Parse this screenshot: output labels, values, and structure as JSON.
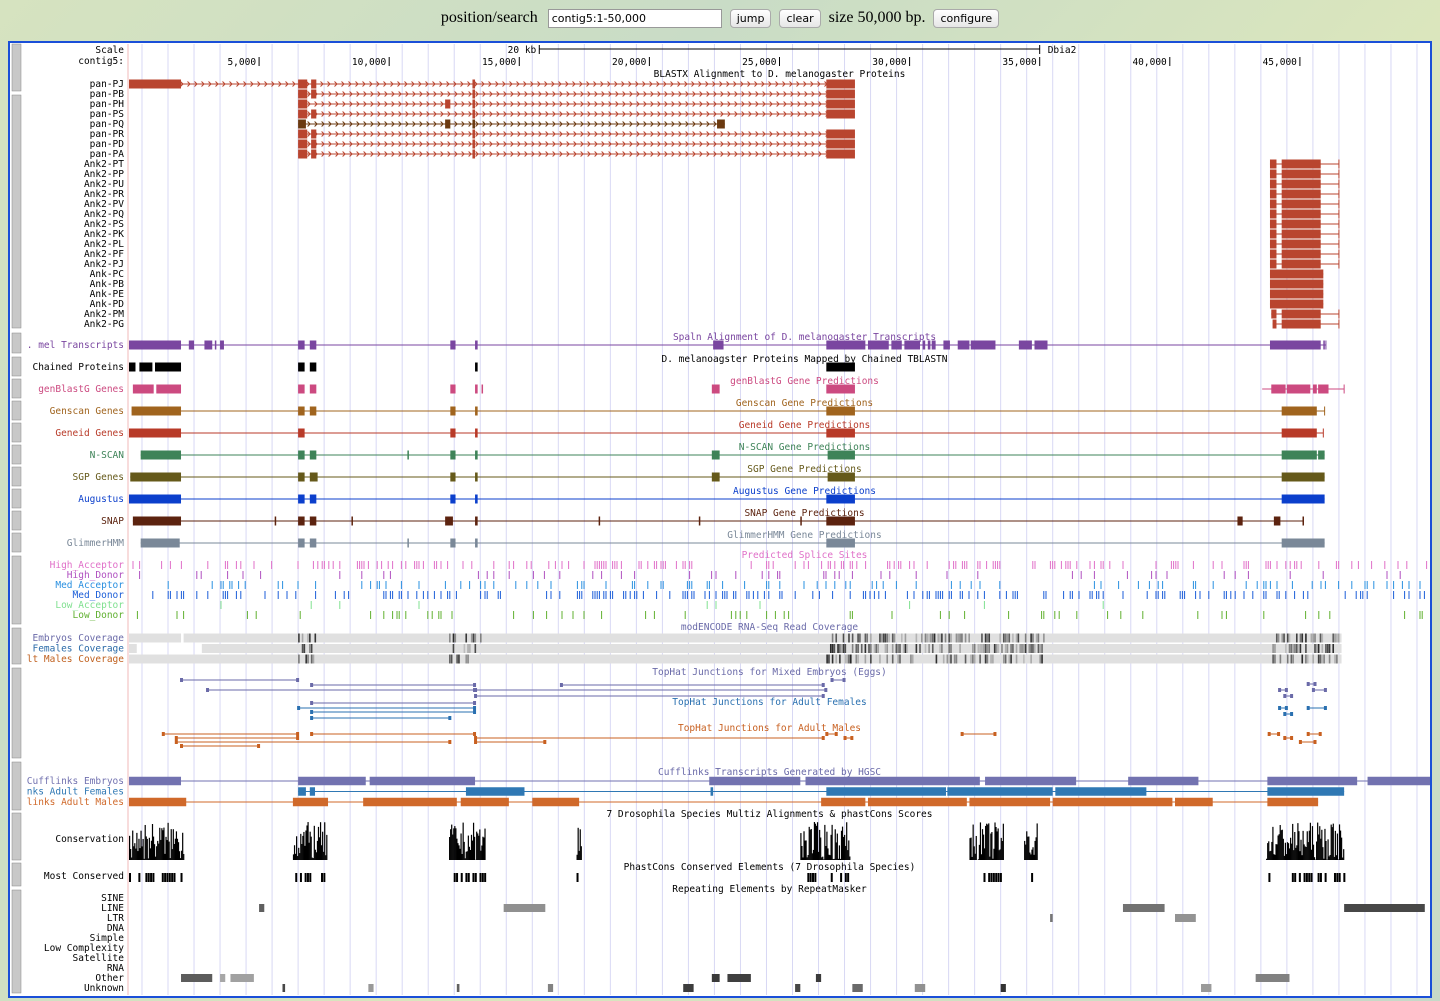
{
  "toolbar": {
    "position_label": "position/search",
    "position_value": "contig5:1-50,000",
    "jump_label": "jump",
    "clear_label": "clear",
    "size_text": "size 50,000 bp.",
    "configure_label": "configure"
  },
  "ruler": {
    "scale_label": "Scale",
    "chrom_label": "contig5:",
    "scale_bar_text": "20 kb",
    "assembly": "Dbia2",
    "ticks": [
      "5,000",
      "10,000",
      "15,000",
      "20,000",
      "25,000",
      "30,000",
      "35,000",
      "40,000",
      "45,000"
    ],
    "tick_positions_bp": [
      5000,
      10000,
      15000,
      20000,
      25000,
      30000,
      35000,
      40000,
      45000
    ],
    "range_bp": [
      1,
      50000
    ]
  },
  "tracks": {
    "blastx": {
      "title": "BLASTX Alignment to D. melanogaster Proteins",
      "color": "#b9452f",
      "alt_color": "#6b3a10",
      "items": [
        {
          "label": "pan-PJ",
          "exons": [
            [
              1,
              2000
            ],
            [
              6500,
              6850
            ],
            [
              7000,
              7200
            ],
            [
              13200,
              13300
            ],
            [
              26800,
              27900
            ]
          ]
        },
        {
          "label": "pan-PB",
          "exons": [
            [
              6500,
              6850
            ],
            [
              7000,
              7200
            ],
            [
              13200,
              13300
            ],
            [
              26800,
              27900
            ]
          ]
        },
        {
          "label": "pan-PH",
          "exons": [
            [
              6500,
              6850
            ],
            [
              12150,
              12350
            ],
            [
              13200,
              13300
            ],
            [
              26800,
              27900
            ]
          ]
        },
        {
          "label": "pan-PS",
          "exons": [
            [
              6500,
              6850
            ],
            [
              7000,
              7200
            ],
            [
              13200,
              13300
            ],
            [
              26800,
              27900
            ]
          ]
        },
        {
          "label": "pan-PQ",
          "exons": [
            [
              6500,
              6800
            ],
            [
              12150,
              12350
            ],
            [
              13200,
              13300
            ],
            [
              22600,
              22900
            ]
          ],
          "alt": true
        },
        {
          "label": "pan-PR",
          "exons": [
            [
              6500,
              6850
            ],
            [
              7000,
              7200
            ],
            [
              13200,
              13300
            ],
            [
              26800,
              27900
            ]
          ]
        },
        {
          "label": "pan-PD",
          "exons": [
            [
              6500,
              6850
            ],
            [
              7000,
              7200
            ],
            [
              13200,
              13300
            ],
            [
              26800,
              27900
            ]
          ]
        },
        {
          "label": "pan-PA",
          "exons": [
            [
              6500,
              6850
            ],
            [
              7000,
              7200
            ],
            [
              13200,
              13300
            ],
            [
              26800,
              27900
            ]
          ]
        },
        {
          "label": "Ank2-PT",
          "exons": [
            [
              43850,
              44100
            ],
            [
              44300,
              45800
            ]
          ],
          "tail": 46500
        },
        {
          "label": "Ank2-PP",
          "exons": [
            [
              43850,
              44100
            ],
            [
              44300,
              45800
            ]
          ],
          "tail": 46500
        },
        {
          "label": "Ank2-PU",
          "exons": [
            [
              43850,
              44100
            ],
            [
              44300,
              45800
            ]
          ],
          "tail": 46500
        },
        {
          "label": "Ank2-PR",
          "exons": [
            [
              43850,
              44100
            ],
            [
              44300,
              45800
            ]
          ],
          "tail": 46500
        },
        {
          "label": "Ank2-PV",
          "exons": [
            [
              43850,
              44100
            ],
            [
              44300,
              45800
            ]
          ],
          "tail": 46500
        },
        {
          "label": "Ank2-PQ",
          "exons": [
            [
              43850,
              44100
            ],
            [
              44300,
              45800
            ]
          ],
          "tail": 46500
        },
        {
          "label": "Ank2-PS",
          "exons": [
            [
              43850,
              44100
            ],
            [
              44300,
              45800
            ]
          ],
          "tail": 46500
        },
        {
          "label": "Ank2-PK",
          "exons": [
            [
              43850,
              44100
            ],
            [
              44300,
              45800
            ]
          ],
          "tail": 46500
        },
        {
          "label": "Ank2-PL",
          "exons": [
            [
              43850,
              44100
            ],
            [
              44300,
              45800
            ]
          ],
          "tail": 46500
        },
        {
          "label": "Ank2-PF",
          "exons": [
            [
              43850,
              44100
            ],
            [
              44300,
              45800
            ]
          ],
          "tail": 46500
        },
        {
          "label": "Ank2-PJ",
          "exons": [
            [
              43850,
              44100
            ],
            [
              44300,
              45800
            ]
          ],
          "tail": 46500
        },
        {
          "label": "Ank-PC",
          "exons": [
            [
              43850,
              45900
            ]
          ]
        },
        {
          "label": "Ank-PB",
          "exons": [
            [
              43850,
              45900
            ]
          ]
        },
        {
          "label": "Ank-PE",
          "exons": [
            [
              43850,
              45900
            ]
          ]
        },
        {
          "label": "Ank-PD",
          "exons": [
            [
              43850,
              45900
            ]
          ]
        },
        {
          "label": "Ank2-PM",
          "exons": [
            [
              43900,
              44100
            ],
            [
              44300,
              45800
            ]
          ],
          "tail": 46500
        },
        {
          "label": "Ank2-PG",
          "exons": [
            [
              43950,
              44100
            ],
            [
              44300,
              45800
            ]
          ],
          "tail": 46500
        }
      ]
    },
    "genes": [
      {
        "label": ". mel Transcripts",
        "title": "Spaln Alignment of D. melanogaster Transcripts",
        "color": "#7a46a0",
        "exons": [
          [
            1,
            2000
          ],
          [
            2300,
            2500
          ],
          [
            2900,
            3200
          ],
          [
            3300,
            3350
          ],
          [
            3500,
            3650
          ],
          [
            6500,
            6750
          ],
          [
            6950,
            7200
          ],
          [
            12350,
            12550
          ],
          [
            13300,
            13400
          ],
          [
            22450,
            22850
          ],
          [
            26800,
            28300
          ],
          [
            28400,
            29200
          ],
          [
            29300,
            29700
          ],
          [
            29800,
            30400
          ],
          [
            30500,
            30600
          ],
          [
            30700,
            30800
          ],
          [
            30850,
            31000
          ],
          [
            31300,
            31550
          ],
          [
            31850,
            32300
          ],
          [
            32350,
            33300
          ],
          [
            34200,
            34700
          ],
          [
            34800,
            35300
          ],
          [
            43850,
            45800
          ],
          [
            45900,
            45950
          ]
        ],
        "tail": 46000
      },
      {
        "label": "Chained Proteins",
        "title": "D. melanoagster Proteins Mapped by Chained TBLASTN",
        "color": "#000000",
        "exons": [
          [
            1,
            250
          ],
          [
            400,
            900
          ],
          [
            1000,
            2000
          ],
          [
            6500,
            6750
          ],
          [
            6950,
            7200
          ],
          [
            13300,
            13400
          ],
          [
            26800,
            27900
          ]
        ],
        "noline": true
      },
      {
        "label": "genBlastG Genes",
        "title": "genBlastG Gene Predictions",
        "color": "#cc4a80",
        "exons": [
          [
            150,
            950
          ],
          [
            1050,
            2000
          ],
          [
            6500,
            6750
          ],
          [
            6950,
            7200
          ],
          [
            12350,
            12550
          ],
          [
            13300,
            13400
          ],
          [
            13550,
            13600
          ],
          [
            22400,
            22700
          ],
          [
            26800,
            27900
          ],
          [
            43900,
            44450
          ],
          [
            44500,
            45400
          ],
          [
            45500,
            45650
          ],
          [
            45700,
            46100
          ]
        ],
        "tail": 46700,
        "head": 43550
      },
      {
        "label": "Genscan Genes",
        "title": "Genscan Gene Predictions",
        "color": "#a0641e",
        "exons": [
          [
            100,
            2000
          ],
          [
            6500,
            6750
          ],
          [
            6950,
            7200
          ],
          [
            12350,
            12550
          ],
          [
            13300,
            13400
          ],
          [
            26800,
            27900
          ],
          [
            44300,
            45650
          ]
        ],
        "tail": 45950
      },
      {
        "label": "Geneid Genes",
        "title": "Geneid Gene Predictions",
        "color": "#b83a28",
        "exons": [
          [
            1,
            2000
          ],
          [
            6500,
            6750
          ],
          [
            12350,
            12550
          ],
          [
            13300,
            13400
          ],
          [
            26800,
            27900
          ],
          [
            44300,
            45650
          ]
        ],
        "tail": 45900
      },
      {
        "label": "N-SCAN",
        "title": "N-SCAN Gene Predictions",
        "color": "#3e8358",
        "exons": [
          [
            450,
            2000
          ],
          [
            6500,
            6750
          ],
          [
            6950,
            7200
          ],
          [
            10700,
            10720
          ],
          [
            12350,
            12550
          ],
          [
            13300,
            13400
          ],
          [
            22400,
            22700
          ],
          [
            26850,
            27900
          ],
          [
            44300,
            45650
          ],
          [
            45700,
            45950
          ]
        ]
      },
      {
        "label": "SGP Genes",
        "title": "SGP Gene Predictions",
        "color": "#65591a",
        "exons": [
          [
            50,
            2000
          ],
          [
            6500,
            6750
          ],
          [
            6950,
            7250
          ],
          [
            12350,
            12550
          ],
          [
            13300,
            13400
          ],
          [
            22400,
            22700
          ],
          [
            26850,
            27900
          ],
          [
            44300,
            45950
          ]
        ]
      },
      {
        "label": "Augustus",
        "title": "Augustus Gene Predictions",
        "color": "#0b3fcc",
        "exons": [
          [
            1,
            2000
          ],
          [
            6500,
            6750
          ],
          [
            6950,
            7200
          ],
          [
            12350,
            12550
          ],
          [
            13300,
            13400
          ],
          [
            26800,
            27900
          ],
          [
            44300,
            45950
          ]
        ]
      },
      {
        "label": "SNAP",
        "title": "SNAP Gene Predictions",
        "color": "#5c230f",
        "exons": [
          [
            150,
            2000
          ],
          [
            5600,
            5620
          ],
          [
            6500,
            6750
          ],
          [
            6950,
            7200
          ],
          [
            8550,
            8570
          ],
          [
            12150,
            12450
          ],
          [
            13300,
            13400
          ],
          [
            18050,
            18100
          ],
          [
            21900,
            21950
          ],
          [
            25800,
            25850
          ],
          [
            26800,
            27900
          ],
          [
            42600,
            42800
          ],
          [
            44000,
            44250
          ],
          [
            45100,
            45150
          ]
        ]
      },
      {
        "label": "GlimmerHMM",
        "title": "GlimmerHMM Gene Predictions",
        "color": "#7a8898",
        "exons": [
          [
            450,
            1950
          ],
          [
            6500,
            6750
          ],
          [
            6950,
            7200
          ],
          [
            10700,
            10720
          ],
          [
            12350,
            12550
          ],
          [
            13300,
            13400
          ],
          [
            26800,
            27900
          ],
          [
            44300,
            45950
          ]
        ]
      }
    ],
    "splice_sites": {
      "title": "Predicted Splice Sites",
      "rows": [
        {
          "label": "High_Acceptor",
          "color": "#e070c8"
        },
        {
          "label": "High_Donor",
          "color": "#b050c0"
        },
        {
          "label": "Med_Acceptor",
          "color": "#2a90e0"
        },
        {
          "label": "Med_Donor",
          "color": "#1c5ed8"
        },
        {
          "label": "Low_Acceptor",
          "color": "#80e090"
        },
        {
          "label": "Low_Donor",
          "color": "#60b030"
        }
      ]
    },
    "rnaseq": {
      "title": "modENCODE RNA-Seq Read Coverage",
      "rows": [
        {
          "label": "Embryos Coverage",
          "color": "#6a6aa8"
        },
        {
          "label": "Females Coverage",
          "color": "#2a6aa8"
        },
        {
          "label": "lt Males Coverage",
          "color": "#c0601e"
        }
      ]
    },
    "tophat": [
      {
        "title": "TopHat Junctions for Mixed Embryos (Eggs)",
        "color": "#6a6aa8"
      },
      {
        "title": "TopHat Junctions for Adult Females",
        "color": "#2a70b0"
      },
      {
        "title": "TopHat Junctions for Adult Males",
        "color": "#c86020"
      }
    ],
    "cufflinks": {
      "title": "Cufflinks Transcripts Generated by HGSC",
      "rows": [
        {
          "label": "Cufflinks Embryos",
          "color": "#7272b0",
          "exons": [
            [
              1,
              2000
            ],
            [
              6500,
              9100
            ],
            [
              9250,
              13300
            ],
            [
              22300,
              25800
            ],
            [
              26000,
              32700
            ],
            [
              32900,
              36400
            ],
            [
              38400,
              41100
            ],
            [
              43750,
              47200
            ],
            [
              47600,
              50000
            ]
          ]
        },
        {
          "label": "nks Adult Females",
          "color": "#2f78b4",
          "exons": [
            [
              6500,
              6800
            ],
            [
              6950,
              7150
            ],
            [
              12950,
              15200
            ],
            [
              22350,
              22450
            ],
            [
              26800,
              31400
            ],
            [
              31450,
              35500
            ],
            [
              35600,
              39100
            ],
            [
              43750,
              46700
            ]
          ]
        },
        {
          "label": "links Adult Males",
          "color": "#d0692a",
          "exons": [
            [
              1,
              2200
            ],
            [
              6300,
              7650
            ],
            [
              9000,
              12600
            ],
            [
              12750,
              14600
            ],
            [
              15500,
              17300
            ],
            [
              26600,
              28300
            ],
            [
              28400,
              32200
            ],
            [
              32300,
              35400
            ],
            [
              35500,
              40100
            ],
            [
              40200,
              41650
            ],
            [
              43750,
              45700
            ]
          ]
        }
      ]
    },
    "conservation": {
      "title": "7 Drosophila Species Multiz Alignments & phastCons Scores",
      "label": "Conservation",
      "most_conserved_label": "Most Conserved",
      "most_conserved_title": "PhastCons Conserved Elements (7 Drosophila Species)"
    },
    "repeatmasker": {
      "title": "Repeating Elements by RepeatMasker",
      "rows": [
        "SINE",
        "LINE",
        "LTR",
        "DNA",
        "Simple",
        "Low Complexity",
        "Satellite",
        "RNA",
        "Other",
        "Unknown"
      ]
    }
  }
}
